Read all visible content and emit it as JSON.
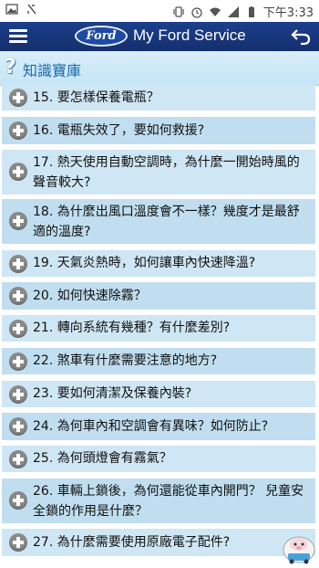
{
  "status_bar": {
    "time": "下午3:33",
    "left_icons": [
      "image-icon",
      "usb-icon"
    ],
    "right_icons": [
      "vibrate-icon",
      "alarm-icon",
      "wifi-icon",
      "signal-icon",
      "battery-icon"
    ]
  },
  "app_bar": {
    "logo_text": "Ford",
    "title": "My Ford Service",
    "brand_color": "#1c3f8d"
  },
  "section": {
    "icon": "?",
    "title": "知識寶庫"
  },
  "items": [
    "15. 要怎樣保養電瓶？",
    "16. 電瓶失效了，要如何救援?",
    "17. 熱天使用自動空調時，為什麼一開始時風的聲音較大?",
    "18. 為什麼出風口溫度會不一樣？幾度才是最舒適的溫度?",
    "19. 天氣炎熱時，如何讓車內快速降溫?",
    "20. 如何快速除霧？",
    "21. 轉向系統有幾種？有什麼差別?",
    "22. 煞車有什麼需要注意的地方?",
    "23. 要如何清潔及保養內裝?",
    "24. 為何車內和空調會有異味？如何防止?",
    "25. 為何頭燈會有霧氣？",
    "26. 車輛上鎖後，為何還能從車內開門？ 兒童安全鎖的作用是什麼？",
    "27. 為什麼需要使用原廠電子配件?"
  ]
}
